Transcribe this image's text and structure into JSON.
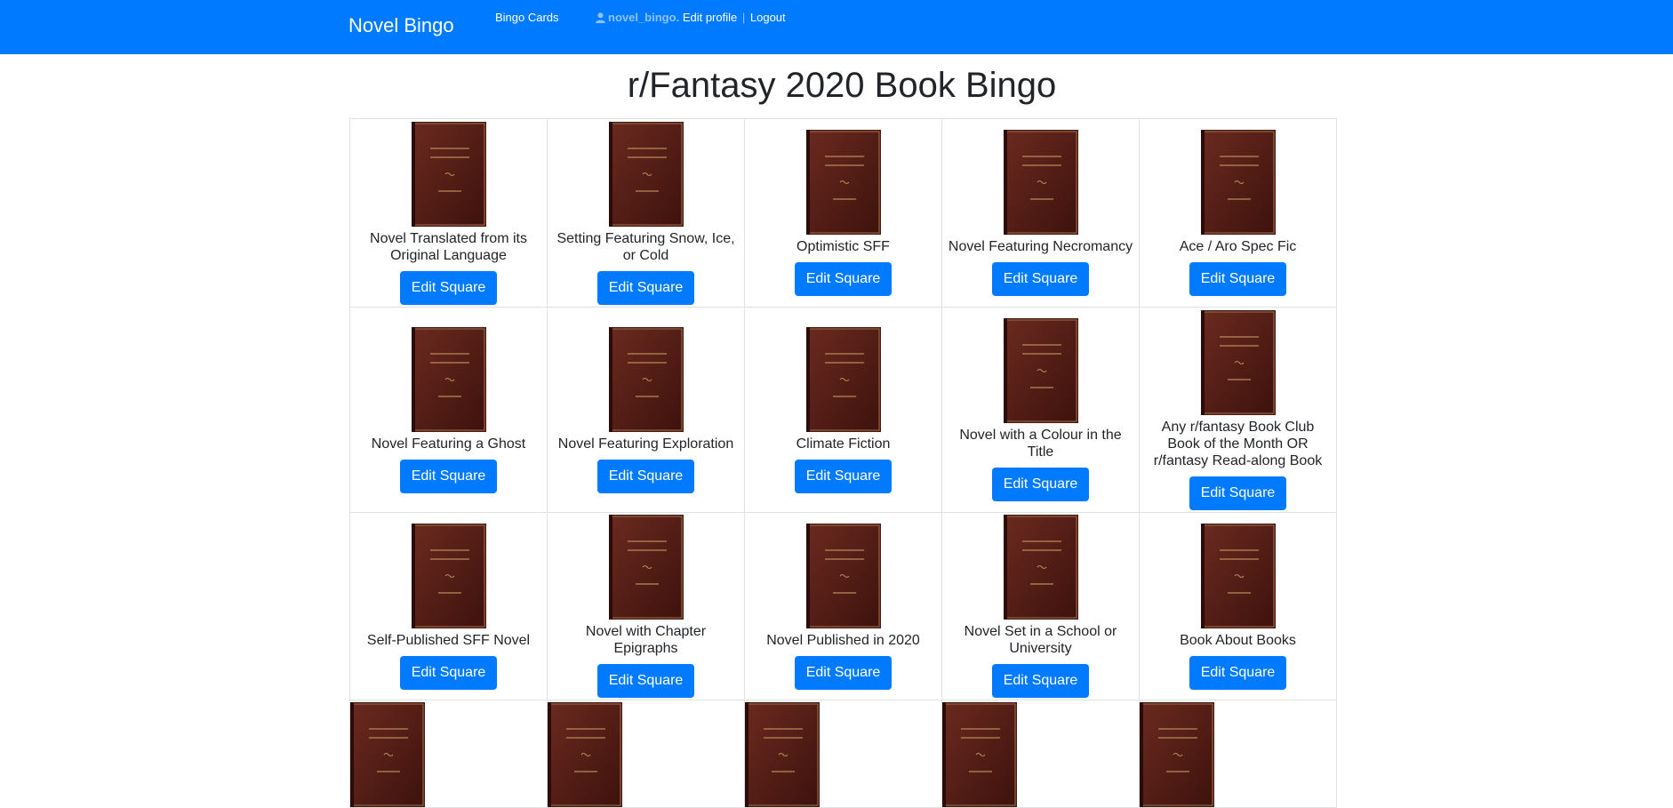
{
  "nav": {
    "brand": "Novel Bingo",
    "bingo_cards": "Bingo Cards",
    "username": "novel_bingo",
    "username_suffix": ".",
    "edit_profile": "Edit profile",
    "separator": "|",
    "logout": "Logout"
  },
  "page": {
    "title": "r/Fantasy 2020 Book Bingo"
  },
  "colors": {
    "navbar": "#007bff",
    "button": "#007bff",
    "book_cover": "#5a1f16",
    "book_lines": "#b88a5a"
  },
  "board": {
    "button_label": "Edit Square",
    "rows": [
      {
        "squares": [
          {
            "label": "Novel Translated from its Original Language"
          },
          {
            "label": "Setting Featuring Snow, Ice, or Cold"
          },
          {
            "label": "Optimistic SFF"
          },
          {
            "label": "Novel Featuring Necromancy"
          },
          {
            "label": "Ace / Aro Spec Fic"
          }
        ]
      },
      {
        "squares": [
          {
            "label": "Novel Featuring a Ghost"
          },
          {
            "label": "Novel Featuring Exploration"
          },
          {
            "label": "Climate Fiction"
          },
          {
            "label": "Novel with a Colour in the Title"
          },
          {
            "label": "Any r/fantasy Book Club Book of the Month OR r/fantasy Read-along Book"
          }
        ]
      },
      {
        "squares": [
          {
            "label": "Self-Published SFF Novel"
          },
          {
            "label": "Novel with Chapter Epigraphs"
          },
          {
            "label": "Novel Published in 2020"
          },
          {
            "label": "Novel Set in a School or University"
          },
          {
            "label": "Book About Books"
          }
        ]
      }
    ]
  }
}
